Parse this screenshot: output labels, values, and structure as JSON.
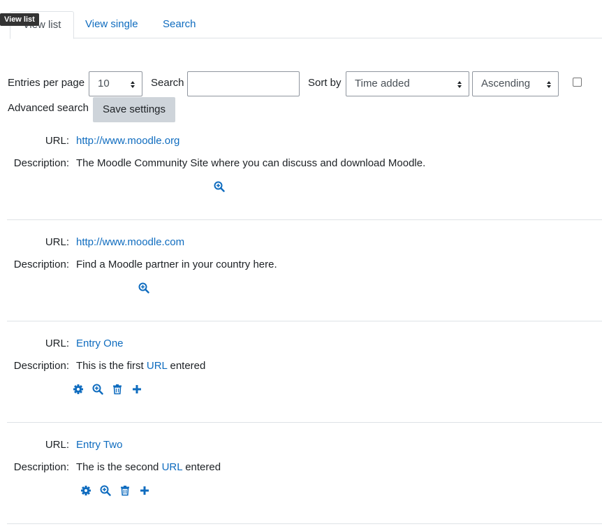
{
  "tooltip": "View list",
  "tabs": [
    {
      "label": "View list",
      "active": true
    },
    {
      "label": "View single",
      "active": false
    },
    {
      "label": "Search",
      "active": false
    }
  ],
  "controls": {
    "entries_label": "Entries per page",
    "entries_value": "10",
    "search_label": "Search",
    "search_value": "",
    "sortby_label": "Sort by",
    "sortby_value": "Time added",
    "order_value": "Ascending",
    "advanced_label": "Advanced search",
    "save_label": "Save settings"
  },
  "field_labels": {
    "url": "URL:",
    "description": "Description:"
  },
  "entries": [
    {
      "url": "http://www.moodle.org",
      "desc_before": "The Moodle Community Site where you can discuss and download Moodle.",
      "desc_link": "",
      "desc_after": "",
      "actions": [
        "zoom-icon"
      ]
    },
    {
      "url": "http://www.moodle.com",
      "desc_before": "Find a Moodle partner in your country here.",
      "desc_link": "",
      "desc_after": "",
      "actions": [
        "zoom-icon"
      ]
    },
    {
      "url": "Entry One",
      "desc_before": "This is the first ",
      "desc_link": "URL",
      "desc_after": " entered",
      "actions": [
        "gear-icon",
        "zoom-icon",
        "trash-icon",
        "plus-icon"
      ]
    },
    {
      "url": "Entry Two",
      "desc_before": "The is the second ",
      "desc_link": "URL",
      "desc_after": " entered",
      "actions": [
        "gear-icon",
        "zoom-icon",
        "trash-icon",
        "plus-icon"
      ]
    }
  ],
  "colors": {
    "link": "#0f6cbf",
    "button_bg": "#ced4da",
    "border": "#dee2e6"
  }
}
